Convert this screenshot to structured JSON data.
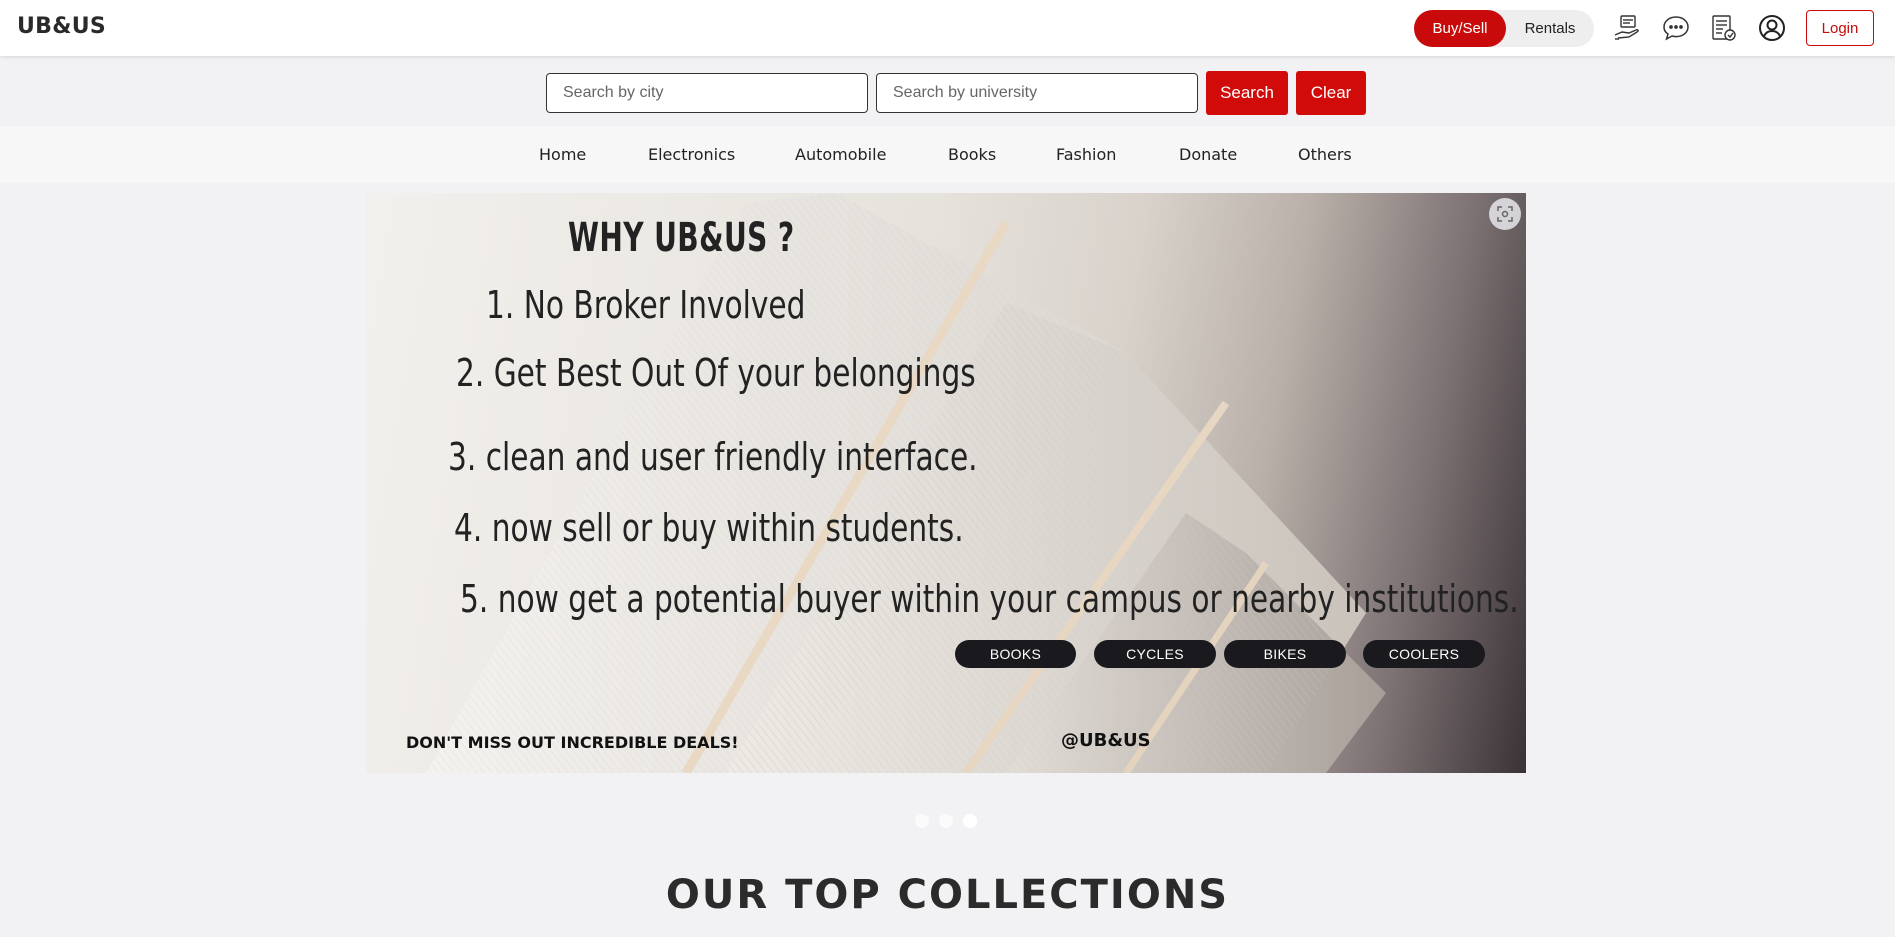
{
  "header": {
    "logo": "UB&US",
    "mode_toggle": {
      "active": "Buy/Sell",
      "inactive": "Rentals"
    },
    "icons": [
      "sell-item-icon",
      "chat-icon",
      "orders-icon",
      "account-icon"
    ],
    "login_label": "Login"
  },
  "search": {
    "city_placeholder": "Search by city",
    "university_placeholder": "Search by university",
    "search_label": "Search",
    "clear_label": "Clear"
  },
  "nav": {
    "items": [
      "Home",
      "Electronics",
      "Automobile",
      "Books",
      "Fashion",
      "Donate",
      "Others"
    ]
  },
  "banner": {
    "title": "WHY UB&US ?",
    "points": [
      "1.  No Broker Involved",
      "2. Get Best Out Of your belongings",
      "3. clean and user friendly interface.",
      "4. now sell or buy within students.",
      "5. now get a potential buyer within your campus or nearby institutions."
    ],
    "tags": [
      "BOOKS",
      "CYCLES",
      "BIKES",
      "COOLERS"
    ],
    "tagline": "DON'T MISS OUT  INCREDIBLE DEALS!",
    "handle": "@UB&US"
  },
  "carousel": {
    "slides": 3,
    "active_slide": 3
  },
  "section": {
    "title": "OUR TOP COLLECTIONS"
  },
  "colors": {
    "accent": "#c80a0a",
    "pill": "#1a1a1e",
    "background": "#f2f2f4"
  }
}
